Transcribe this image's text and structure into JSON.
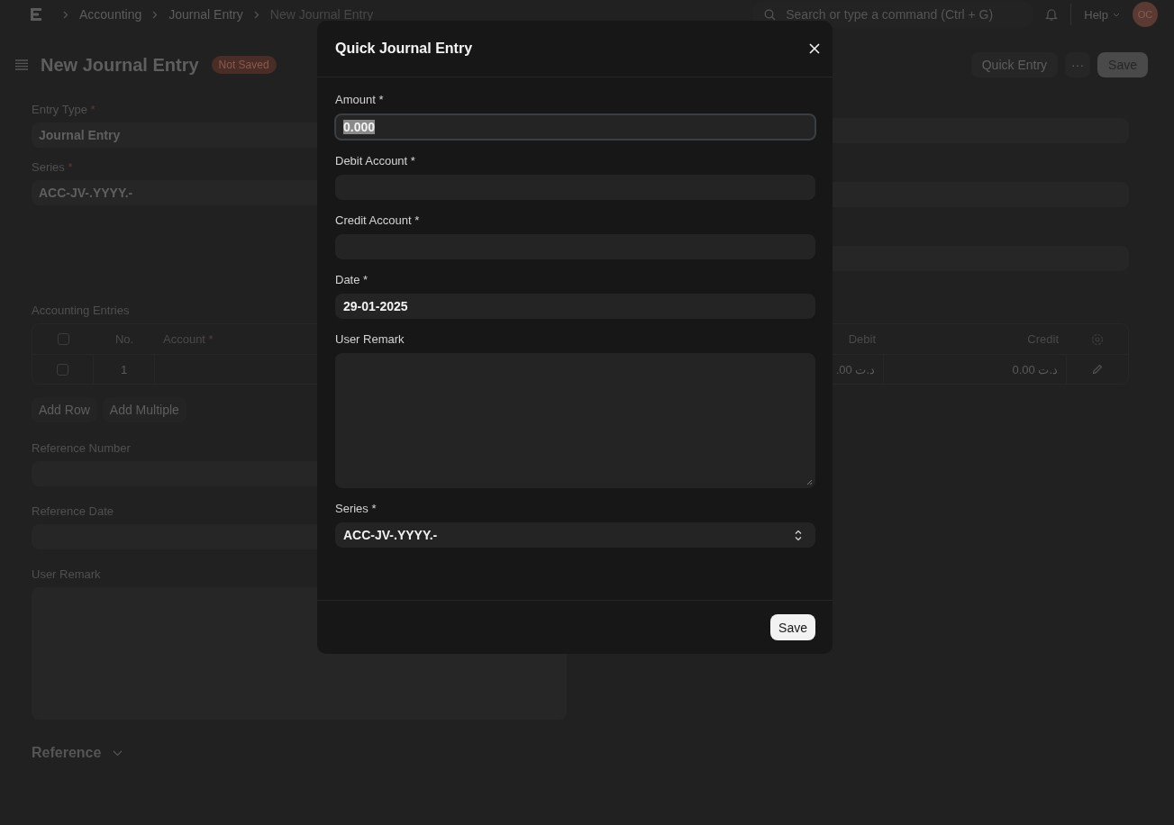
{
  "topbar": {
    "breadcrumbs": [
      {
        "label": "Accounting",
        "current": false
      },
      {
        "label": "Journal Entry",
        "current": false
      },
      {
        "label": "New Journal Entry",
        "current": true
      }
    ],
    "search": {
      "placeholder": "Search or type a command (Ctrl + G)"
    },
    "help": "Help",
    "avatar": "OC"
  },
  "page_header": {
    "title": "New Journal Entry",
    "status": "Not Saved",
    "actions": [
      {
        "kind": "button",
        "label": "Quick Entry"
      },
      {
        "kind": "more",
        "label": "···"
      },
      {
        "kind": "primary",
        "label": "Save"
      }
    ]
  },
  "form": {
    "left_fields": [
      {
        "label": "Entry Type",
        "required_mark": "*",
        "value": "Journal Entry"
      },
      {
        "label": "Series",
        "required_mark": "*",
        "value": "ACC-JV-.YYYY.-"
      }
    ]
  },
  "table": {
    "title": "Accounting Entries",
    "header_checked": false,
    "columns": [
      {
        "label": "No."
      },
      {
        "label": "Account",
        "required_mark": "*"
      },
      {
        "label": "Debit"
      },
      {
        "label": "Credit"
      }
    ],
    "rows": [
      {
        "checked": false,
        "no": "1",
        "debit": ".00 د.ت",
        "credit": "0.00 د.ت"
      }
    ],
    "buttons": [
      "Add Row",
      "Add Multiple"
    ]
  },
  "reference_fields": [
    {
      "label": "Reference Number",
      "kind": "input"
    },
    {
      "label": "Reference Date",
      "kind": "input"
    },
    {
      "label": "User Remark",
      "kind": "textarea"
    }
  ],
  "section": {
    "title": "Reference"
  },
  "dialog": {
    "title": "Quick Journal Entry",
    "fields": [
      {
        "label": "Amount *",
        "kind": "input",
        "value": "0.000",
        "focused": true,
        "text_selected": true
      },
      {
        "label": "Debit Account *",
        "kind": "input",
        "focused": false
      },
      {
        "label": "Credit Account *",
        "kind": "input",
        "focused": false
      },
      {
        "label": "Date *",
        "kind": "input",
        "value": "29-01-2025",
        "focused": false
      },
      {
        "label": "User Remark",
        "kind": "textarea",
        "focused": false
      },
      {
        "label": "Series *",
        "kind": "select",
        "value": "ACC-JV-.YYYY.-",
        "focused": false
      }
    ],
    "primary_button": "Save"
  }
}
